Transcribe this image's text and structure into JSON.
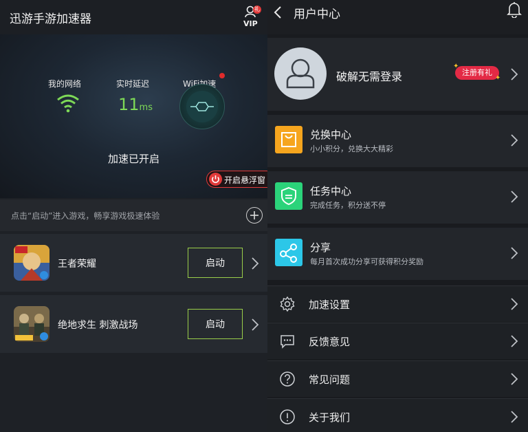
{
  "left_app": {
    "title": "迅游手游加速器",
    "vip_label": "VIP",
    "vip_badge": "礼",
    "stats": {
      "network_label": "我的网络",
      "latency_label": "实时延迟",
      "latency_value": "11",
      "latency_unit": "ms",
      "wifi_label": "WiFi加速"
    },
    "status": "加速已开启",
    "float_window": "开启悬浮窗",
    "hint": "点击“启动”进入游戏，畅享游戏极速体验",
    "games": [
      {
        "name": "王者荣耀",
        "launch": "启动"
      },
      {
        "name": "绝地求生 刺激战场",
        "launch": "启动"
      }
    ]
  },
  "right_app": {
    "title": "用户中心",
    "profile": {
      "name": "破解无需登录",
      "register_badge": "注册有礼"
    },
    "features": [
      {
        "title": "兑换中心",
        "subtitle": "小小积分，兑换大大精彩",
        "color": "#f6a51e"
      },
      {
        "title": "任务中心",
        "subtitle": "完成任务，积分送不停",
        "color": "#2bd37a"
      },
      {
        "title": "分享",
        "subtitle": "每月首次成功分享可获得积分奖励",
        "color": "#2cc7e8"
      }
    ],
    "settings": [
      {
        "label": "加速设置",
        "icon": "gear-icon"
      },
      {
        "label": "反馈意见",
        "icon": "chat-icon"
      },
      {
        "label": "常见问题",
        "icon": "question-icon"
      },
      {
        "label": "关于我们",
        "icon": "info-icon"
      }
    ]
  },
  "colors": {
    "accent_green": "#7ed957",
    "launch_border": "#9bd04a",
    "badge_red": "#e32a45"
  }
}
